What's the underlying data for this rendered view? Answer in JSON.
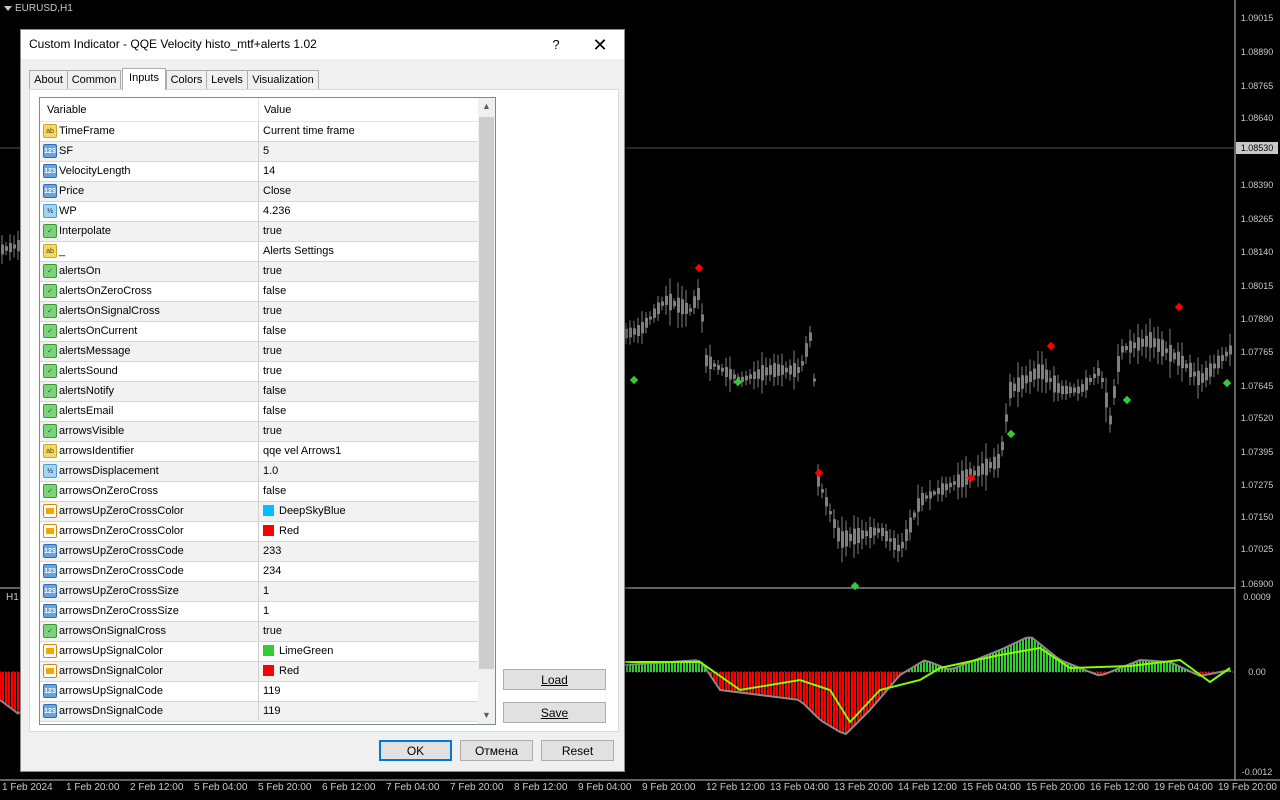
{
  "chart": {
    "symbol": "EURUSD,H1",
    "subwindow_label": "H1",
    "current_price": "1.08530",
    "price_ticks": [
      "1.09015",
      "1.08890",
      "1.08765",
      "1.08640",
      "1.08390",
      "1.08265",
      "1.08140",
      "1.08015",
      "1.07890",
      "1.07765",
      "1.07645",
      "1.07520",
      "1.07395",
      "1.07275",
      "1.07150",
      "1.07025",
      "1.06900"
    ],
    "sub_ticks": [
      "0.0009",
      "0.00",
      "-0.0012"
    ],
    "time_ticks": [
      "1 Feb 2024",
      "1 Feb 20:00",
      "2 Feb 12:00",
      "5 Feb 04:00",
      "5 Feb 20:00",
      "6 Feb 12:00",
      "7 Feb 04:00",
      "7 Feb 20:00",
      "8 Feb 12:00",
      "9 Feb 04:00",
      "9 Feb 20:00",
      "12 Feb 12:00",
      "13 Feb 04:00",
      "13 Feb 20:00",
      "14 Feb 12:00",
      "15 Feb 04:00",
      "15 Feb 20:00",
      "16 Feb 12:00",
      "19 Feb 04:00",
      "19 Feb 20:00"
    ],
    "colors": {
      "bg": "#000000",
      "candle": "#7f7f7f",
      "up_arrow": "#32cd32",
      "down_arrow": "#ff0000",
      "histo_up": "#32cd32",
      "histo_dn": "#ff0000",
      "signal": "#7fff00"
    }
  },
  "dialog": {
    "title": "Custom Indicator - QQE Velocity histo_mtf+alerts 1.02",
    "help_icon": "?",
    "close_icon": "✕",
    "tabs": [
      {
        "label": "About"
      },
      {
        "label": "Common"
      },
      {
        "label": "Inputs",
        "active": true
      },
      {
        "label": "Colors"
      },
      {
        "label": "Levels"
      },
      {
        "label": "Visualization"
      }
    ],
    "grid": {
      "col_variable": "Variable",
      "col_value": "Value",
      "rows": [
        {
          "type": "str",
          "icon": "ab",
          "name": "TimeFrame",
          "value": "Current time frame"
        },
        {
          "type": "int",
          "icon": "123",
          "name": "SF",
          "value": "5"
        },
        {
          "type": "int",
          "icon": "123",
          "name": "VelocityLength",
          "value": "14"
        },
        {
          "type": "int",
          "icon": "123",
          "name": "Price",
          "value": "Close"
        },
        {
          "type": "dbl",
          "icon": "½",
          "name": "WP",
          "value": "4.236"
        },
        {
          "type": "bool",
          "icon": "✓",
          "name": "Interpolate",
          "value": "true"
        },
        {
          "type": "str",
          "icon": "ab",
          "name": "_",
          "value": "Alerts Settings"
        },
        {
          "type": "bool",
          "icon": "✓",
          "name": "alertsOn",
          "value": "true"
        },
        {
          "type": "bool",
          "icon": "✓",
          "name": "alertsOnZeroCross",
          "value": "false"
        },
        {
          "type": "bool",
          "icon": "✓",
          "name": "alertsOnSignalCross",
          "value": "true"
        },
        {
          "type": "bool",
          "icon": "✓",
          "name": "alertsOnCurrent",
          "value": "false"
        },
        {
          "type": "bool",
          "icon": "✓",
          "name": "alertsMessage",
          "value": "true"
        },
        {
          "type": "bool",
          "icon": "✓",
          "name": "alertsSound",
          "value": "true"
        },
        {
          "type": "bool",
          "icon": "✓",
          "name": "alertsNotify",
          "value": "false"
        },
        {
          "type": "bool",
          "icon": "✓",
          "name": "alertsEmail",
          "value": "false"
        },
        {
          "type": "bool",
          "icon": "✓",
          "name": "arrowsVisible",
          "value": "true"
        },
        {
          "type": "str",
          "icon": "ab",
          "name": "arrowsIdentifier",
          "value": "qqe vel Arrows1"
        },
        {
          "type": "dbl",
          "icon": "½",
          "name": "arrowsDisplacement",
          "value": "1.0"
        },
        {
          "type": "bool",
          "icon": "✓",
          "name": "arrowsOnZeroCross",
          "value": "false"
        },
        {
          "type": "col",
          "icon": "",
          "name": "arrowsUpZeroCrossColor",
          "value": "DeepSkyBlue",
          "swatch": "#00bfff"
        },
        {
          "type": "col",
          "icon": "",
          "name": "arrowsDnZeroCrossColor",
          "value": "Red",
          "swatch": "#ff0000"
        },
        {
          "type": "int",
          "icon": "123",
          "name": "arrowsUpZeroCrossCode",
          "value": "233"
        },
        {
          "type": "int",
          "icon": "123",
          "name": "arrowsDnZeroCrossCode",
          "value": "234"
        },
        {
          "type": "int",
          "icon": "123",
          "name": "arrowsUpZeroCrossSize",
          "value": "1"
        },
        {
          "type": "int",
          "icon": "123",
          "name": "arrowsDnZeroCrossSize",
          "value": "1"
        },
        {
          "type": "bool",
          "icon": "✓",
          "name": "arrowsOnSignalCross",
          "value": "true"
        },
        {
          "type": "col",
          "icon": "",
          "name": "arrowsUpSignalColor",
          "value": "LimeGreen",
          "swatch": "#32cd32"
        },
        {
          "type": "col",
          "icon": "",
          "name": "arrowsDnSignalColor",
          "value": "Red",
          "swatch": "#ff0000"
        },
        {
          "type": "int",
          "icon": "123",
          "name": "arrowsUpSignalCode",
          "value": "119"
        },
        {
          "type": "int",
          "icon": "123",
          "name": "arrowsDnSignalCode",
          "value": "119"
        }
      ]
    },
    "side_buttons": {
      "load": "Load",
      "save": "Save"
    },
    "footer_buttons": {
      "ok": "OK",
      "cancel": "Отмена",
      "reset": "Reset"
    }
  }
}
